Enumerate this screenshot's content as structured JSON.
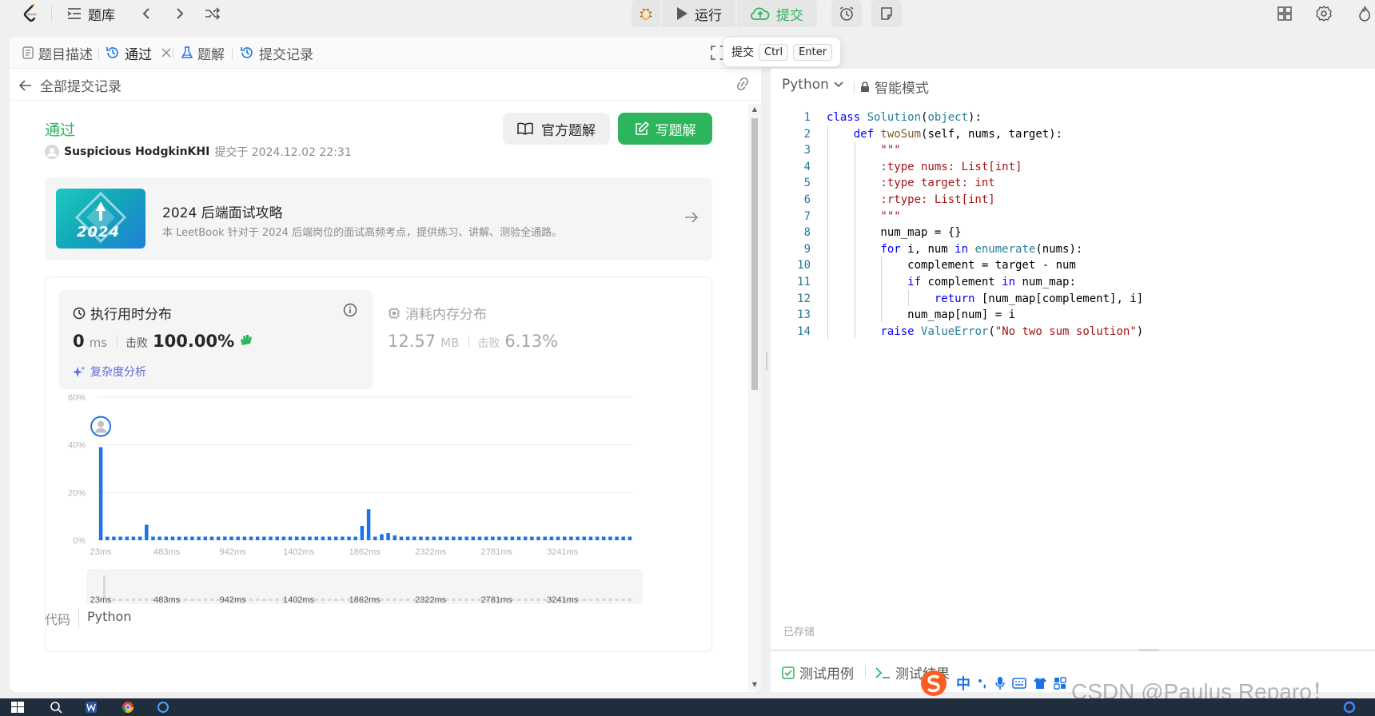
{
  "topbar": {
    "problems_label": "题库",
    "run_label": "运行",
    "submit_label": "提交"
  },
  "tabs": [
    {
      "label": "题目描述"
    },
    {
      "label": "通过"
    },
    {
      "label": "题解"
    },
    {
      "label": "提交记录"
    }
  ],
  "tooltip": {
    "label": "提交",
    "key1": "Ctrl",
    "key2": "Enter"
  },
  "subheader": {
    "back_label": "全部提交记录"
  },
  "submission": {
    "status": "通过",
    "author": "Suspicious HodgkinKHI",
    "submitted_at": "提交于 2024.12.02 22:31",
    "official_solution_label": "官方题解",
    "write_solution_label": "写题解"
  },
  "banner": {
    "image_text": "2024",
    "title": "2024 后端面试攻略",
    "desc": "本 LeetBook 针对于 2024 后端岗位的面试高频考点，提供练习、讲解、测验全通路。"
  },
  "runtime": {
    "title": "执行用时分布",
    "value": "0",
    "unit": "ms",
    "beat_label": "击败",
    "beat_value": "100.00%",
    "complexity_label": "复杂度分析"
  },
  "memory": {
    "title": "消耗内存分布",
    "value": "12.57",
    "unit": "MB",
    "beat_label": "击败",
    "beat_value": "6.13%"
  },
  "chart_data": {
    "type": "bar",
    "title": "",
    "xlabel": "",
    "ylabel": "",
    "ylim": [
      0,
      60
    ],
    "y_ticks": [
      "0%",
      "20%",
      "40%",
      "60%"
    ],
    "y_tick_values": [
      0,
      20,
      40,
      60
    ],
    "x_ticks": [
      "23ms",
      "483ms",
      "942ms",
      "1402ms",
      "1862ms",
      "2322ms",
      "2781ms",
      "3241ms"
    ],
    "grid": true,
    "bar_color": "#1a73e8",
    "highlight_bin": 0,
    "values": [
      39,
      1.5,
      1.5,
      1.5,
      1.5,
      1.5,
      1.5,
      6.5,
      1.5,
      1.5,
      1.5,
      1.5,
      1.5,
      1.5,
      1.5,
      1.5,
      1.5,
      1.5,
      1.5,
      1.5,
      1.5,
      1.5,
      1.5,
      1.5,
      1.5,
      1.5,
      1.5,
      1.5,
      1.5,
      1.5,
      1.5,
      1.5,
      1.5,
      1.5,
      1.5,
      1.5,
      1.5,
      1.5,
      1.5,
      1.5,
      6,
      13,
      1.5,
      2.5,
      3,
      2,
      1.5,
      1.5,
      1.5,
      1.5,
      1.5,
      1.5,
      1.5,
      1.5,
      1.5,
      1.5,
      1.5,
      1.5,
      1.5,
      1.5,
      1.5,
      1.5,
      1.5,
      1.5,
      1.5,
      1.5,
      1.5,
      1.5,
      1.5,
      1.5,
      1.5,
      1.5,
      1.5,
      1.5,
      1.5,
      1.5,
      1.5,
      1.5,
      1.5,
      1.5,
      1.5,
      1.5
    ]
  },
  "code_footer": {
    "label": "代码",
    "lang": "Python"
  },
  "editor": {
    "language": "Python",
    "mode_label": "智能模式",
    "saved_label": "已存储",
    "lines": [
      "class Solution(object):",
      "    def twoSum(self, nums, target):",
      "        \"\"\"",
      "        :type nums: List[int]",
      "        :type target: int",
      "        :rtype: List[int]",
      "        \"\"\"",
      "        num_map = {}",
      "        for i, num in enumerate(nums):",
      "            complement = target - num",
      "            if complement in num_map:",
      "                return [num_map[complement], i]",
      "            num_map[num] = i",
      "        raise ValueError(\"No two sum solution\")"
    ]
  },
  "bottom_tabs": [
    {
      "label": "测试用例"
    },
    {
      "label": "测试结果"
    }
  ],
  "ime": {
    "char": "中"
  },
  "watermark": "CSDN @Paulus Reparo！",
  "colors": {
    "accent_green": "#2db55d",
    "bar_blue": "#1a73e8",
    "complexity_purple": "#5d6bdc"
  }
}
